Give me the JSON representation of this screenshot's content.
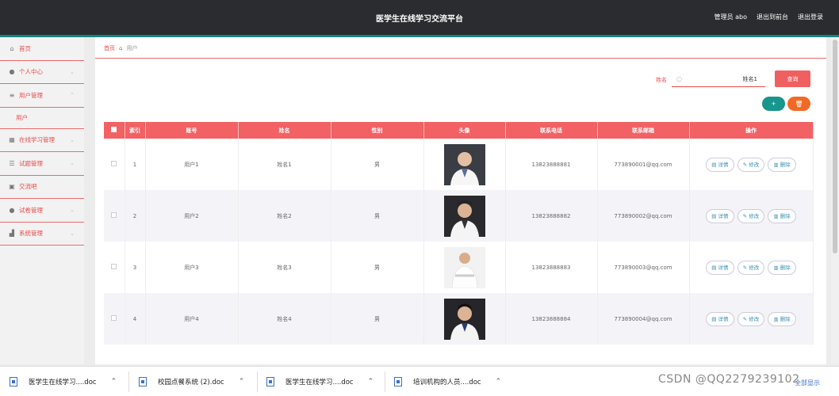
{
  "header": {
    "title": "医学生在线学习交流平台",
    "user": "管理员 abo",
    "back": "退出到前台",
    "logout": "退出登录"
  },
  "sidebar": {
    "items": [
      {
        "label": "首页",
        "icon": "home-icon"
      },
      {
        "label": "个人中心",
        "icon": "user-icon"
      },
      {
        "label": "用户管理",
        "icon": "list-icon"
      },
      {
        "label": "在线学习管理",
        "icon": "grid-icon"
      },
      {
        "label": "试题管理",
        "icon": "sliders-icon"
      },
      {
        "label": "交流吧",
        "icon": "clipboard-icon"
      },
      {
        "label": "试卷管理",
        "icon": "user-icon"
      },
      {
        "label": "系统管理",
        "icon": "chart-icon"
      }
    ],
    "sub_item": "用户"
  },
  "breadcrumb": {
    "home": "首页",
    "current": "用户"
  },
  "search": {
    "label": "姓名",
    "value": "姓名1",
    "button": "查询"
  },
  "buttons": {
    "add": "+",
    "delete": "🗑"
  },
  "table": {
    "headers": [
      "",
      "索引",
      "账号",
      "姓名",
      "性别",
      "头像",
      "联系电话",
      "联系邮箱",
      "操作"
    ],
    "rows": [
      {
        "index": "1",
        "account": "用户1",
        "name": "姓名1",
        "gender": "男",
        "phone": "13823888881",
        "email": "773890001@qq.com"
      },
      {
        "index": "2",
        "account": "用户2",
        "name": "姓名2",
        "gender": "男",
        "phone": "13823888882",
        "email": "773890002@qq.com"
      },
      {
        "index": "3",
        "account": "用户3",
        "name": "姓名3",
        "gender": "男",
        "phone": "13823888883",
        "email": "773890003@qq.com"
      },
      {
        "index": "4",
        "account": "用户4",
        "name": "姓名4",
        "gender": "男",
        "phone": "13823888884",
        "email": "773890004@qq.com"
      }
    ],
    "ops": {
      "detail": "详情",
      "edit": "修改",
      "remove": "删除"
    }
  },
  "downloads": [
    {
      "name": "医学生在线学习....doc"
    },
    {
      "name": "校园点餐系统 (2).doc"
    },
    {
      "name": "医学生在线学习....doc"
    },
    {
      "name": "培训机构的人员....doc"
    }
  ],
  "show_all": "全部显示",
  "watermark": "CSDN @QQ2279239102",
  "colors": {
    "accent": "#f26164",
    "topbar": "#2a2c2f",
    "teal": "#17847f",
    "orange": "#f06a25"
  }
}
